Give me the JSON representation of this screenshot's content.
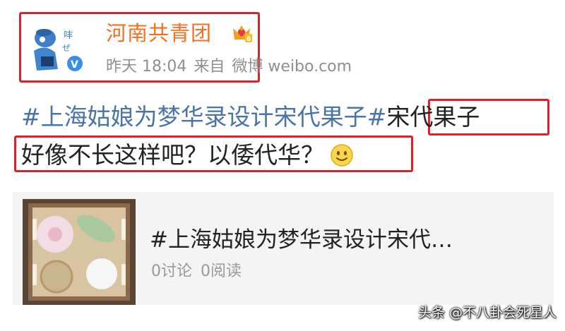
{
  "account": {
    "name": "河南共青团",
    "time": "昨天 18:04",
    "source_prefix": "来自",
    "source": "微博 weibo.com"
  },
  "post": {
    "hashtag": "#上海姑娘为梦华录设计宋代果子#",
    "line1_tail": "宋代果子",
    "line2": "好像不长这样吧？以倭代华？"
  },
  "card": {
    "title": "#上海姑娘为梦华录设计宋代…",
    "discussions": "0讨论",
    "reads": "0阅读"
  },
  "watermark": "头条 @不八卦会死星人",
  "colors": {
    "highlight_box": "#e0202a",
    "account_name": "#f36f21",
    "hashtag": "#4a73a8"
  },
  "icons": [
    "avatar-mascot",
    "member-crown-badge",
    "verified-badge",
    "smiley-emoji",
    "sweets-thumbnail"
  ]
}
